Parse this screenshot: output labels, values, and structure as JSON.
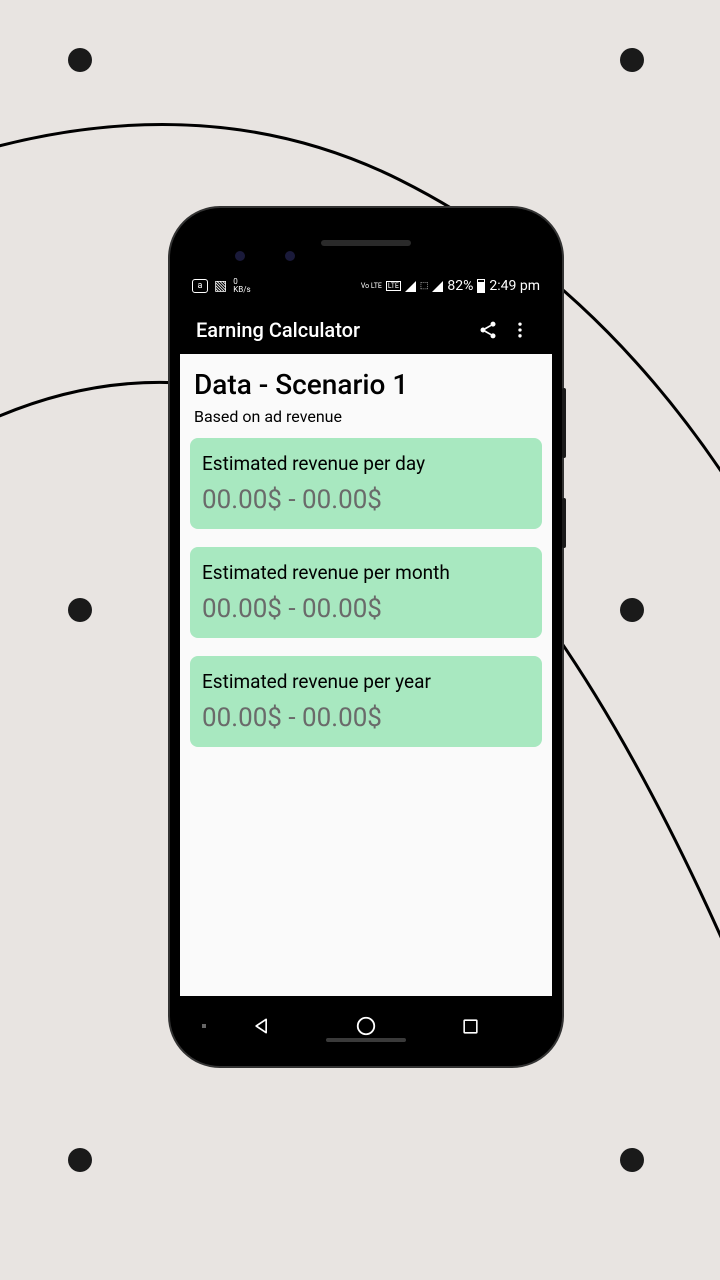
{
  "status": {
    "net_speed": "0",
    "net_unit": "KB/s",
    "volte": "Vo LTE",
    "lte": "LTE",
    "battery_pct": "82%",
    "time": "2:49 pm"
  },
  "appbar": {
    "title": "Earning Calculator"
  },
  "page": {
    "title": "Data - Scenario 1",
    "subtitle": "Based on ad revenue"
  },
  "cards": [
    {
      "label": "Estimated revenue per day",
      "value": "00.00$  -  00.00$"
    },
    {
      "label": "Estimated revenue per month",
      "value": "00.00$  -  00.00$"
    },
    {
      "label": "Estimated revenue per year",
      "value": "00.00$  -  00.00$"
    }
  ]
}
